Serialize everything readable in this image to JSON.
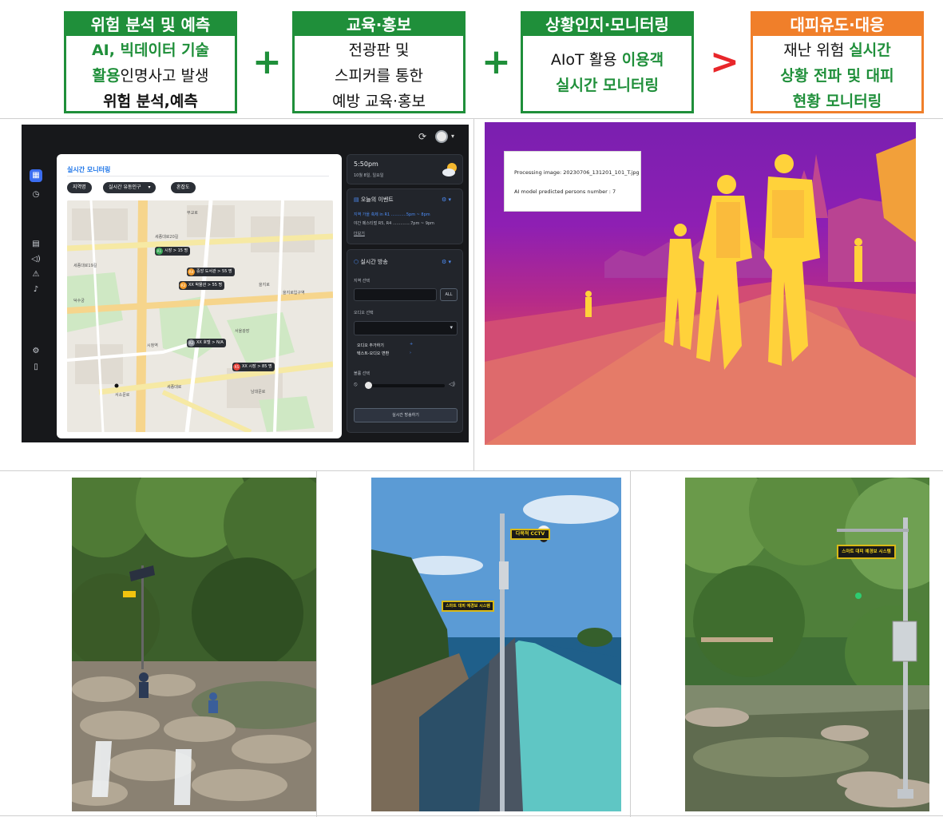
{
  "process": {
    "analysis": {
      "title": "위험 분석 및 예측",
      "line1": "AI, 빅데이터 기술",
      "line2a": "활용",
      "line2b": "인명사고 발생",
      "line3": "위험 분석,예측"
    },
    "education": {
      "title": "교육·홍보",
      "line1": "전광판 및",
      "line2": "스피커를 통한",
      "line3": "예방 교육·홍보"
    },
    "monitoring": {
      "title": "상황인지·모니터링",
      "line1a": "AIoT 활용 ",
      "line1b": "이용객",
      "line2": "실시간 모니터링"
    },
    "response": {
      "title": "대피유도·대응",
      "line1a": "재난 위험 ",
      "line1b": "실시간",
      "line2": "상황 전파 및 대피",
      "line3": "현황 모니터링"
    },
    "op_plus": "+",
    "op_gt": ">",
    "colors": {
      "green": "#1f8f3a",
      "orange": "#f07f2a",
      "red": "#e8262a"
    }
  },
  "dashboard": {
    "map_title": "실시간 모니터링",
    "filters": [
      "지역명",
      "실시간 유동인구",
      "혼잡도"
    ],
    "map_markers": [
      {
        "badge": "R1",
        "text": "시장 > 15 명",
        "color": "#3aa757"
      },
      {
        "badge": "R4",
        "text": "중앙 도서관 > 55 명",
        "color": "#f29b2a"
      },
      {
        "badge": "R3",
        "text": "XX 박물관 > 55 명",
        "color": "#f29b2a"
      },
      {
        "badge": "R2",
        "text": "XX 호텔 > N/A",
        "color": "#8a8f98"
      },
      {
        "badge": "R5",
        "text": "XX 시장 > 85 명",
        "color": "#e8423a"
      }
    ],
    "map_places": [
      "무교로",
      "세종대로20길",
      "세종대로19길",
      "을지로",
      "을지로입구역",
      "덕수궁",
      "시청역",
      "서울광장",
      "세종대로",
      "서소문로",
      "남대문로"
    ],
    "weather": {
      "time": "5:50pm",
      "date": "10월 8일, 일요일"
    },
    "events": {
      "title": "오늘의 이벤트",
      "item1": "지역 가을 축제 in R1 ............5pm ~ 8pm",
      "item2": "야간 페스티벌 R5, R4 ..............7pm ~ 9pm",
      "more": "더보기"
    },
    "broadcast": {
      "title": "실시간 방송",
      "region_label": "지역 선택",
      "all_button": "ALL",
      "audio_label": "오디오 선택",
      "add_audio": "오디오 추가하기",
      "tts": "텍스트-오디오 변환",
      "volume_label": "볼륨 선택",
      "volume_level": 0.04,
      "start_button": "실시간 방송하기"
    }
  },
  "thermal": {
    "processing": "Processing image: 20230706_131201_101_T.jpg",
    "persons": "AI model predicted persons number : 7",
    "person_count": 7
  },
  "signs": {
    "cctv": "다목적 CCTV",
    "system1": "스마트 대피 예경보 시스템",
    "system2": "스마트 대피 예경보 시스템"
  }
}
